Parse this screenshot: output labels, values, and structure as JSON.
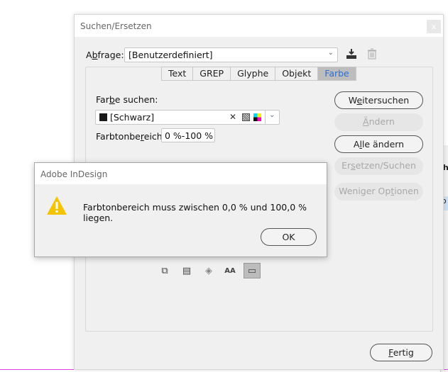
{
  "dialog": {
    "title": "Suchen/Ersetzen",
    "close_label": "x",
    "query_label_pre": "A",
    "query_label_u": "b",
    "query_label_post": "frage:",
    "query_value": "[Benutzerdefiniert]",
    "tabs": [
      {
        "label": "Text"
      },
      {
        "label": "GREP"
      },
      {
        "label": "Glyphe"
      },
      {
        "label": "Objekt"
      },
      {
        "label": "Farbe",
        "active": true
      }
    ],
    "find_color_label_pre": "Far",
    "find_color_label_u": "b",
    "find_color_label_post": "e suchen:",
    "color_value": "[Schwarz]",
    "tint_label_pre": "Farbtonbe",
    "tint_label_u": "r",
    "tint_label_post": "eich:",
    "tint_value": "0 %-100 %",
    "buttons": {
      "find_next": {
        "pre": "W",
        "u": "e",
        "post": "itersuchen"
      },
      "change": {
        "pre": "",
        "u": "Ä",
        "post": "ndern"
      },
      "change_all": {
        "pre": "A",
        "u": "l",
        "post": "le ändern"
      },
      "change_find": {
        "pre": "Er",
        "u": "s",
        "post": "etzen/Suchen"
      },
      "fewer_options": {
        "pre": "Weniger Op",
        "u": "t",
        "post": "ionen"
      },
      "done": {
        "pre": "",
        "u": "F",
        "post": "ertig"
      }
    },
    "option_icons": [
      "locked-layers-icon",
      "locked-stories-icon",
      "hidden-layers-icon",
      "master-pages-icon",
      "footnotes-icon"
    ]
  },
  "alert": {
    "title": "Adobe InDesign",
    "message": "Farbtonbereich muss zwischen 0,0 % und 100,0 % liegen.",
    "ok_label": "OK",
    "warning_color": "#f5c400"
  },
  "background": {
    "fragment_1": "h",
    "fragment_2": "o"
  }
}
